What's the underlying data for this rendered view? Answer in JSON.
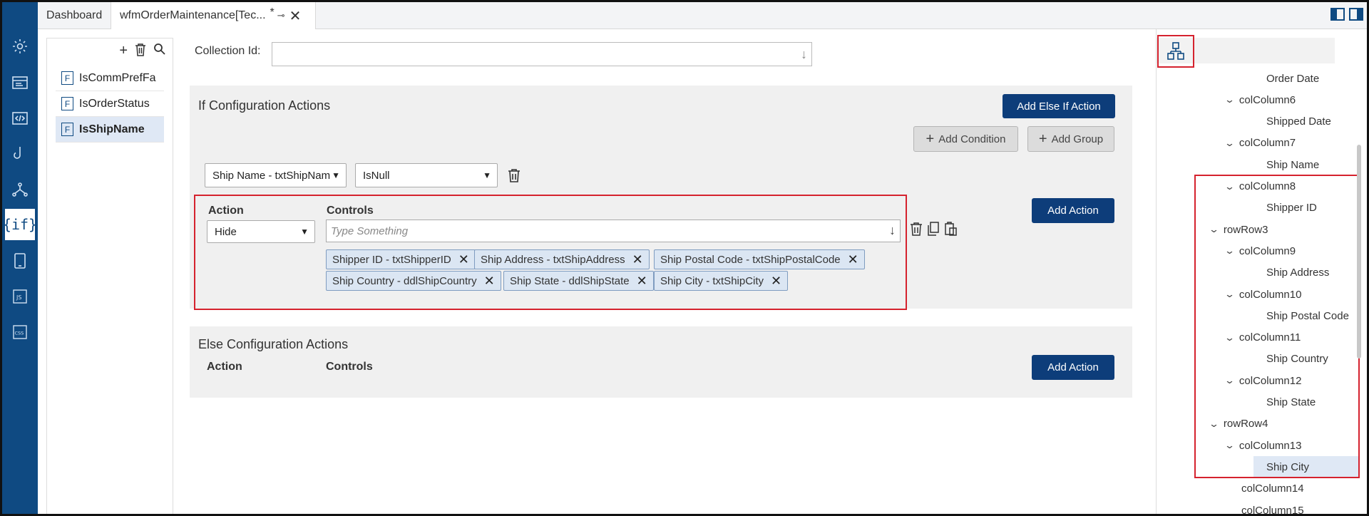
{
  "tabs": {
    "dashboard": "Dashboard",
    "active": "wfmOrderMaintenance[Tec...",
    "modified_marker": "*"
  },
  "rail": {
    "items": [
      "settings-icon",
      "form-icon",
      "code-icon",
      "hook-icon",
      "workflow-icon",
      "if-rules-icon",
      "tablet-icon",
      "js-icon",
      "css-icon"
    ],
    "active": "if-rules-icon",
    "if_label": "{if}",
    "js_label": "JS",
    "css_label": "CSS"
  },
  "rules_panel": {
    "items": [
      {
        "badge": "F",
        "label": "IsCommPrefFa",
        "selected": false
      },
      {
        "badge": "F",
        "label": "IsOrderStatus",
        "selected": false
      },
      {
        "badge": "F",
        "label": "IsShipName",
        "selected": true
      }
    ]
  },
  "collection": {
    "label": "Collection Id:",
    "value": ""
  },
  "if_section": {
    "title": "If Configuration Actions",
    "add_else_if": "Add Else If Action",
    "add_condition": "Add Condition",
    "add_group": "Add Group",
    "condition_field": "Ship Name - txtShipNam",
    "condition_operator": "IsNull",
    "action_header": "Action",
    "controls_header": "Controls",
    "action_value": "Hide",
    "controls_placeholder": "Type Something",
    "add_action": "Add Action",
    "chips": [
      "Shipper ID - txtShipperID",
      "Ship Address - txtShipAddress",
      "Ship Postal Code - txtShipPostalCode",
      "Ship Country - ddlShipCountry",
      "Ship State - ddlShipState",
      "Ship City - txtShipCity"
    ]
  },
  "else_section": {
    "title": "Else Configuration Actions",
    "action_header": "Action",
    "controls_header": "Controls",
    "add_action": "Add Action"
  },
  "tree": {
    "nodes": [
      {
        "label": "Order Date",
        "level": 3,
        "toggle": ""
      },
      {
        "label": "colColumn6",
        "level": 2,
        "toggle": "v"
      },
      {
        "label": "Shipped Date",
        "level": 3,
        "toggle": ""
      },
      {
        "label": "colColumn7",
        "level": 2,
        "toggle": "v"
      },
      {
        "label": "Ship Name",
        "level": 3,
        "toggle": ""
      },
      {
        "label": "colColumn8",
        "level": 2,
        "toggle": "v"
      },
      {
        "label": "Shipper ID",
        "level": 3,
        "toggle": ""
      },
      {
        "label": "rowRow3",
        "level": 1,
        "toggle": "v"
      },
      {
        "label": "colColumn9",
        "level": 2,
        "toggle": "v"
      },
      {
        "label": "Ship Address",
        "level": 3,
        "toggle": ""
      },
      {
        "label": "colColumn10",
        "level": 2,
        "toggle": "v"
      },
      {
        "label": "Ship Postal Code",
        "level": 3,
        "toggle": ""
      },
      {
        "label": "colColumn11",
        "level": 2,
        "toggle": "v"
      },
      {
        "label": "Ship Country",
        "level": 3,
        "toggle": ""
      },
      {
        "label": "colColumn12",
        "level": 2,
        "toggle": "v"
      },
      {
        "label": "Ship State",
        "level": 3,
        "toggle": ""
      },
      {
        "label": "rowRow4",
        "level": 1,
        "toggle": "v"
      },
      {
        "label": "colColumn13",
        "level": 2,
        "toggle": "v"
      },
      {
        "label": "Ship City",
        "level": 3,
        "toggle": "",
        "selected": true
      },
      {
        "label": "colColumn14",
        "level": 2,
        "toggle": ""
      },
      {
        "label": "colColumn15",
        "level": 2,
        "toggle": ""
      }
    ]
  },
  "colors": {
    "rail": "#0f4a82",
    "primary_button": "#0d3d7a",
    "highlight_border": "#d5222e",
    "chip_bg": "#dbe6f3",
    "selected_bg": "#dfe8f5"
  }
}
